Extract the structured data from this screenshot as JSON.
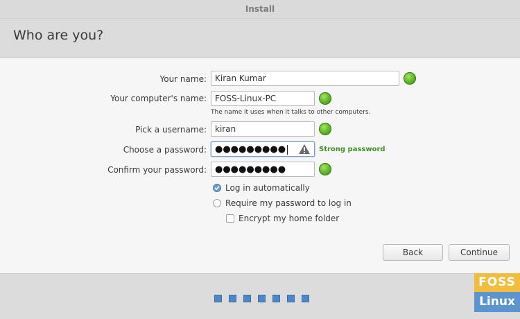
{
  "window": {
    "title": "Install"
  },
  "page": {
    "heading": "Who are you?"
  },
  "form": {
    "name": {
      "label": "Your name:",
      "value": "Kiran Kumar"
    },
    "computer": {
      "label": "Your computer's name:",
      "value": "FOSS-Linux-PC",
      "hint": "The name it uses when it talks to other computers."
    },
    "username": {
      "label": "Pick a username:",
      "value": "kiran"
    },
    "password": {
      "label": "Choose a password:",
      "value": "●●●●●●●●●",
      "strength": "Strong password"
    },
    "confirm": {
      "label": "Confirm your password:",
      "value": "●●●●●●●●●"
    },
    "options": {
      "auto_login": "Log in automatically",
      "require_password": "Require my password to log in",
      "encrypt_home": "Encrypt my home folder"
    }
  },
  "buttons": {
    "back": "Back",
    "continue": "Continue"
  },
  "progress": {
    "total": 7,
    "completed": 7
  },
  "watermark": {
    "line1": "FOSS",
    "line2": "Linux"
  },
  "colors": {
    "accent": "#4f86c6",
    "ok": "#5ab025",
    "strong": "#3e8f24"
  }
}
